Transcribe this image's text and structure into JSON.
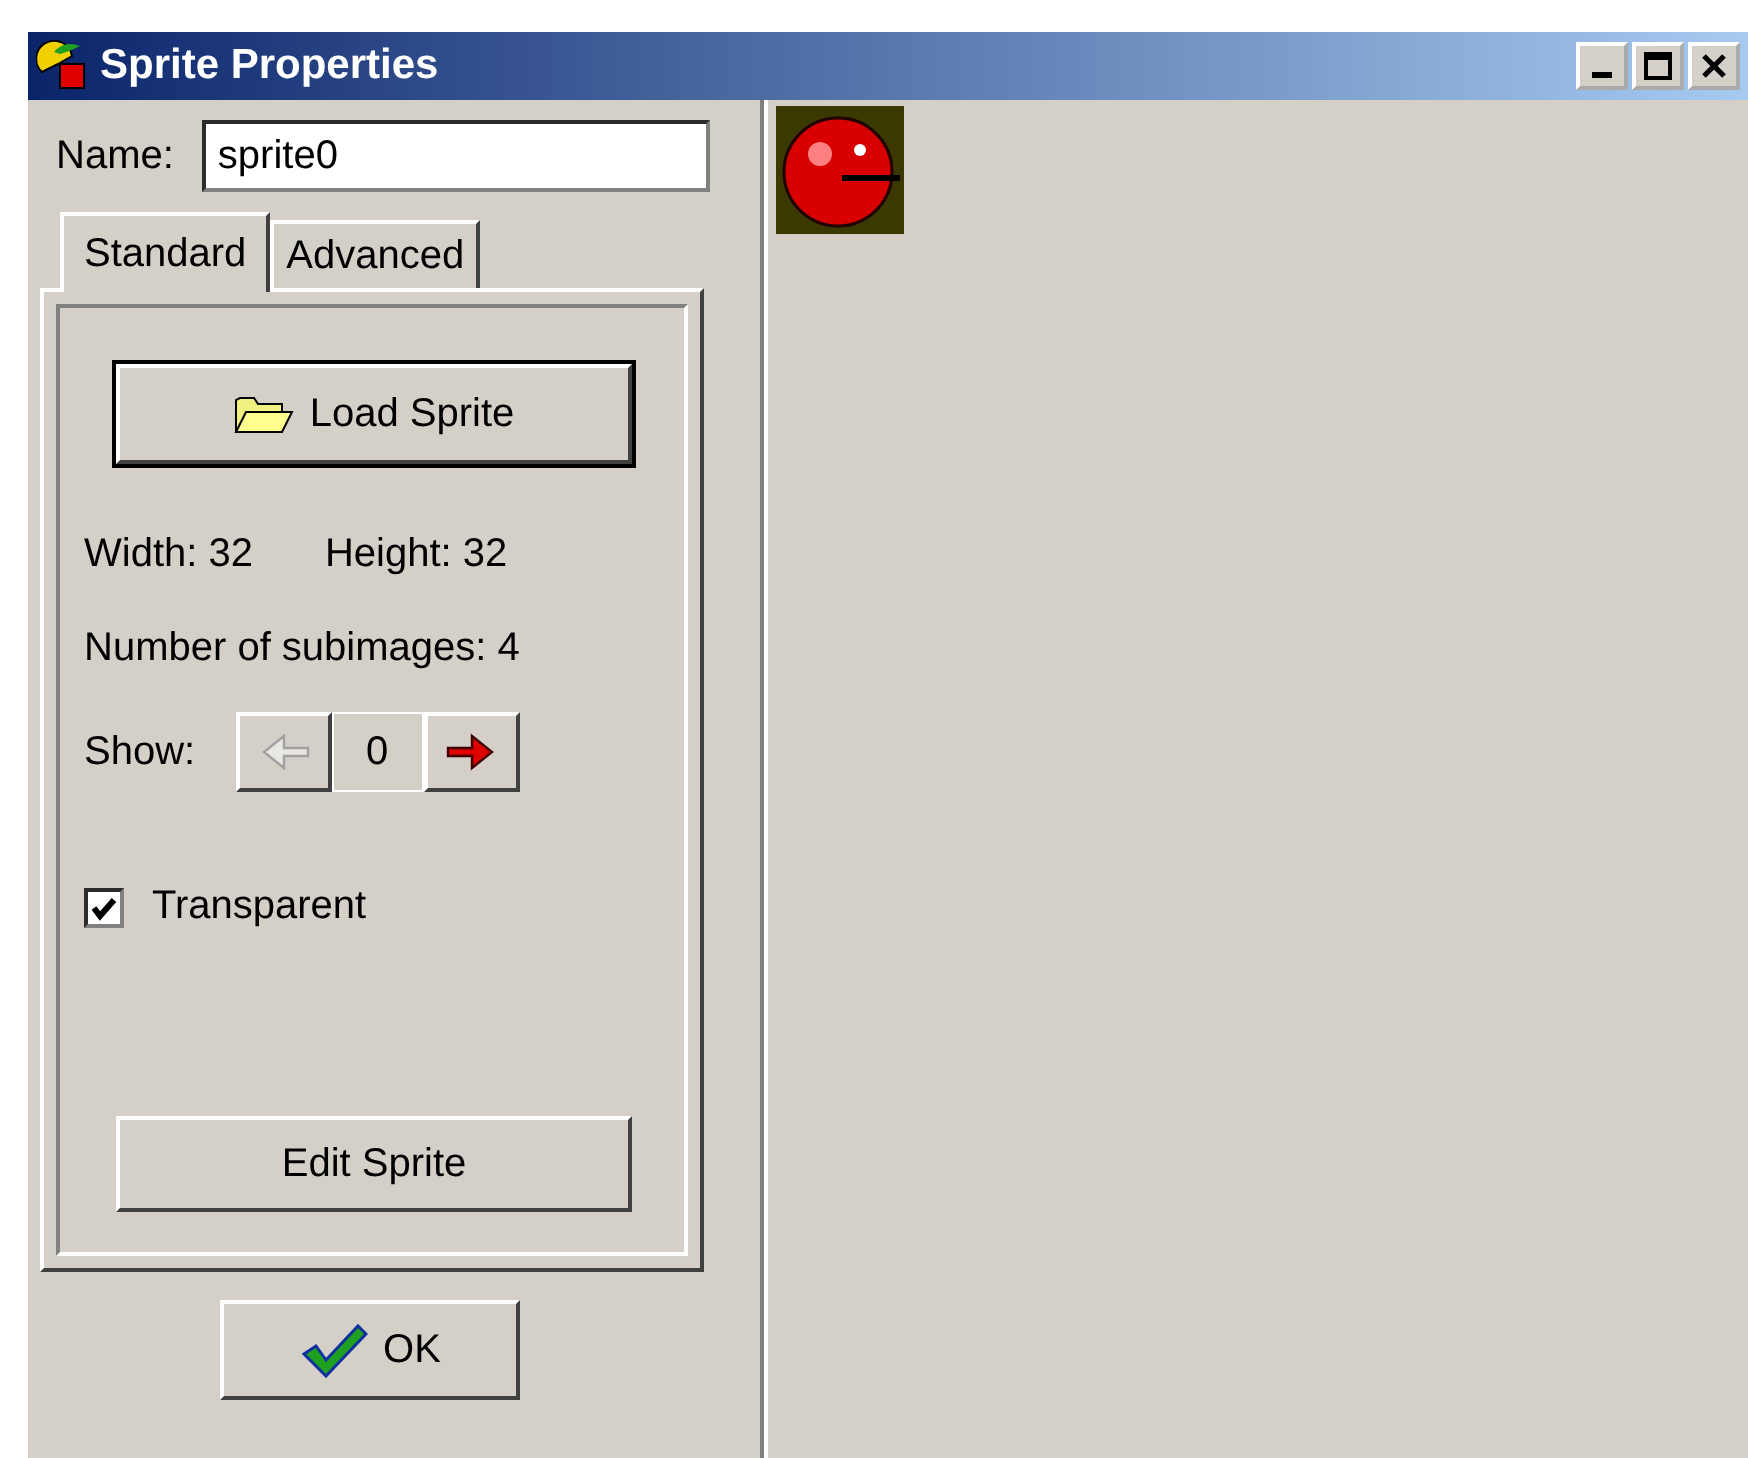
{
  "window": {
    "title": "Sprite Properties"
  },
  "name_field": {
    "label": "Name:",
    "value": "sprite0"
  },
  "tabs": [
    {
      "label": "Standard",
      "selected": true
    },
    {
      "label": "Advanced",
      "selected": false
    }
  ],
  "load_button": {
    "label": "Load Sprite"
  },
  "width_label": "Width: 32",
  "height_label": "Height: 32",
  "subimages_label": "Number of subimages: 4",
  "show": {
    "label": "Show:",
    "value": "0",
    "prev_disabled": true,
    "next_disabled": false
  },
  "transparent": {
    "label": "Transparent",
    "checked": true
  },
  "edit_button": {
    "label": "Edit Sprite"
  },
  "ok_button": {
    "label": "OK"
  }
}
